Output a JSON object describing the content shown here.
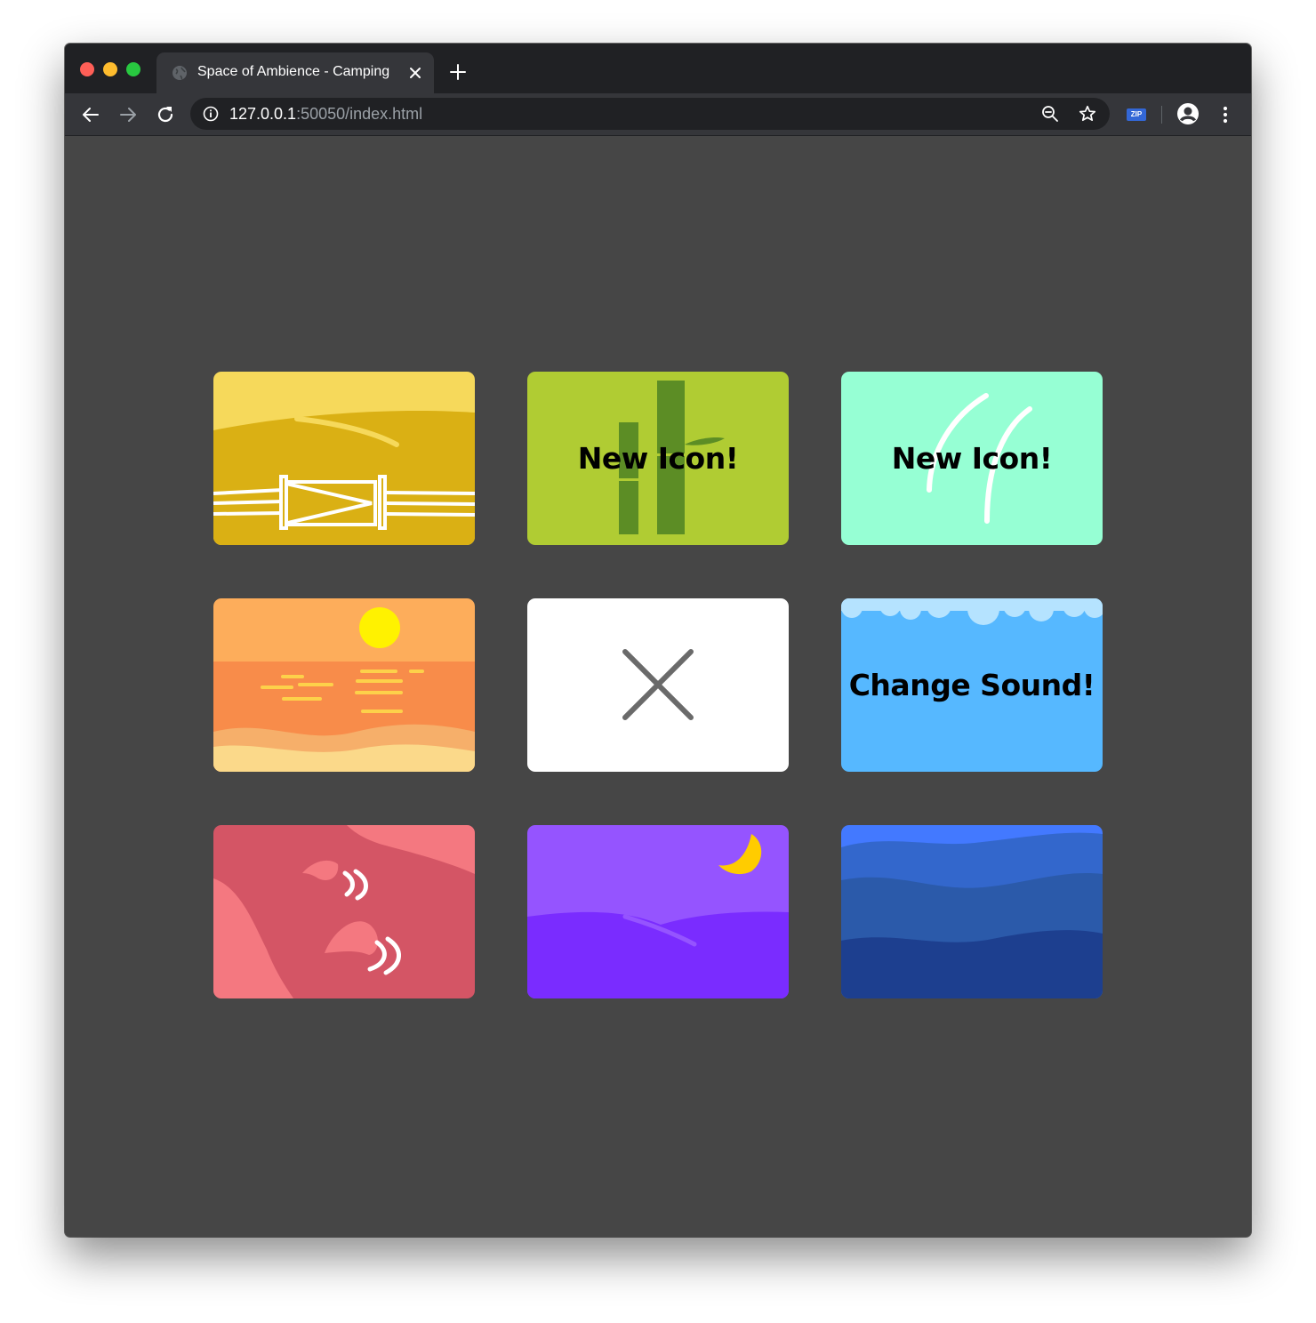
{
  "window": {
    "tab": {
      "title": "Space of Ambience - Camping",
      "favicon": "globe-icon"
    },
    "toolbar": {
      "url_host": "127.0.0.1",
      "url_rest": ":50050/index.html",
      "extension_label": "ZIP"
    }
  },
  "grid": {
    "tiles": [
      {
        "id": "meadow",
        "label": "",
        "bg": "#dab014"
      },
      {
        "id": "bamboo",
        "label": "New Icon!",
        "bg": "#b0cc33"
      },
      {
        "id": "wind",
        "label": "New Icon!",
        "bg": "#96ffd4"
      },
      {
        "id": "sunset-beach",
        "label": "",
        "bg": "#f88c4a"
      },
      {
        "id": "empty-slot",
        "label": "",
        "bg": "#ffffff",
        "icon": "close-x-icon"
      },
      {
        "id": "sky",
        "label": "Change Sound!",
        "bg": "#56b8ff"
      },
      {
        "id": "campfire",
        "label": "",
        "bg": "#d45565"
      },
      {
        "id": "night",
        "label": "",
        "bg": "#7a2cff",
        "icon": "moon-icon"
      },
      {
        "id": "ocean",
        "label": "",
        "bg": "#2b5aaa"
      }
    ]
  }
}
